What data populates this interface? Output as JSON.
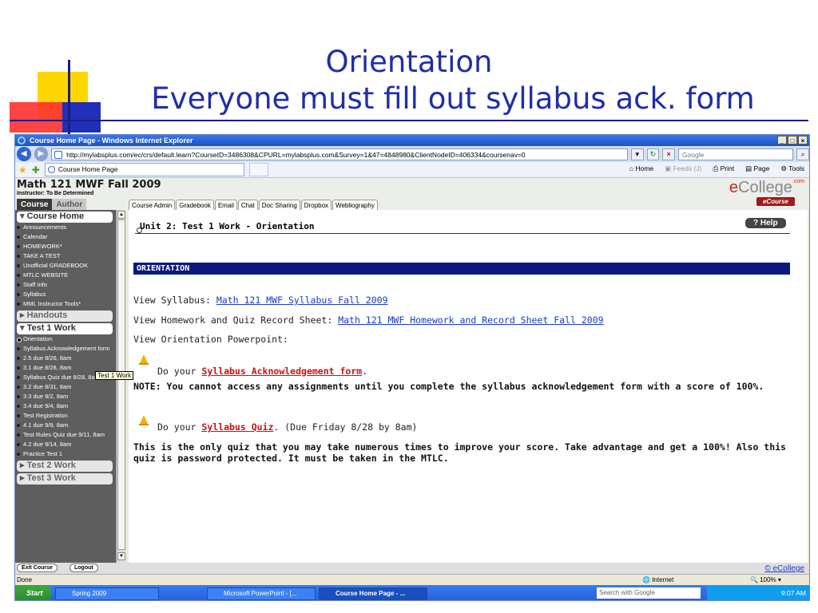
{
  "slide": {
    "title_line1": "Orientation",
    "title_line2": "Everyone must fill out syllabus ack. form"
  },
  "browser": {
    "window_title": "Course Home Page - Windows Internet Explorer",
    "address": "http://mylabsplus.com/ec/crs/default.learn?CourseID=3486308&CPURL=mylabsplus.com&Survey=1&47=4848980&ClientNodeID=406334&coursenav=0",
    "search_placeholder": "Google",
    "tab_label": "Course Home Page",
    "cmd_home": "Home",
    "cmd_feeds": "Feeds (J)",
    "cmd_print": "Print",
    "cmd_page": "Page",
    "cmd_tools": "Tools"
  },
  "course": {
    "title": "Math 121 MWF Fall 2009",
    "instructor": "Instructor: To Be Determined",
    "toggle_course": "Course",
    "toggle_author": "Author",
    "logo_e": "e",
    "logo_rest": "College",
    "logo_com": ".com",
    "logo_badge": "eCourse",
    "menu_tabs": [
      "Course Admin",
      "Gradebook",
      "Email",
      "Chat",
      "Doc Sharing",
      "Dropbox",
      "Webliography"
    ]
  },
  "sidebar": {
    "course_home": "Course Home",
    "course_home_items": [
      "Announcements",
      "Calendar",
      "HOMEWORK*",
      "TAKE A TEST",
      "Unofficial GRADEBOOK",
      "MTLC WEBSITE",
      "Staff Info",
      "Syllabus",
      "MML Instructor Tools*"
    ],
    "handouts": "Handouts",
    "test1": "Test 1 Work",
    "test1_items": [
      "Orientation",
      "Syllabus Acknowledgement form",
      "2.5 due 8/26, 8am",
      "3.1 due 8/28, 8am",
      "Syllabus Quiz due 8/28, 8am",
      "3.2 due 8/31, 8am",
      "3.3 due 9/2, 8am",
      "3.4 due 9/4, 8am",
      "Test Registration",
      "4.1 due 9/9, 8am",
      "Test Rules Quiz due 9/11, 8am",
      "4.2 due 9/14, 8am",
      "Practice Test 1"
    ],
    "test2": "Test 2 Work",
    "test3": "Test 3 Work",
    "tooltip": "Test 1 Work"
  },
  "content": {
    "unit_heading": "Unit 2: Test 1 Work - Orientation",
    "help": "Help",
    "section": "ORIENTATION",
    "syllabus_prefix": "View Syllabus: ",
    "syllabus_link": "Math 121 MWF Syllabus Fall 2009",
    "hw_prefix": "View Homework and Quiz Record Sheet: ",
    "hw_link": "Math 121 MWF Homework and Record Sheet Fall 2009",
    "ppt": "View Orientation Powerpoint:",
    "do_your": "Do your ",
    "ack_link": "Syllabus Acknowledgement form",
    "note": "NOTE: You cannot access any assignments until you complete the syllabus acknowledgement form with a score of 100%.",
    "quiz_link": "Syllabus Quiz",
    "quiz_suffix": ". (Due Friday 8/28 by 8am)",
    "quiz_note": "This is the only quiz that you may take numerous times to improve your score. Take advantage and get a 100%! Also this quiz is password protected. It must be taken in the MTLC."
  },
  "footer": {
    "exit": "Exit Course",
    "logout": "Logout",
    "copyright": "© eCollege"
  },
  "status": {
    "text": "Done",
    "zone": "Internet",
    "zoom": "100%"
  },
  "taskbar": {
    "start": "Start",
    "items": [
      "Spring 2009",
      "Microsoft PowerPoint - [...",
      "Course Home Page - ..."
    ],
    "search_placeholder": "Search with Google",
    "clock": "9:07 AM"
  },
  "colors": {
    "title_blue": "#1f2ea8",
    "section_bar": "#0c1a80",
    "link": "#1a3acc",
    "alert_red": "#cc1111"
  }
}
